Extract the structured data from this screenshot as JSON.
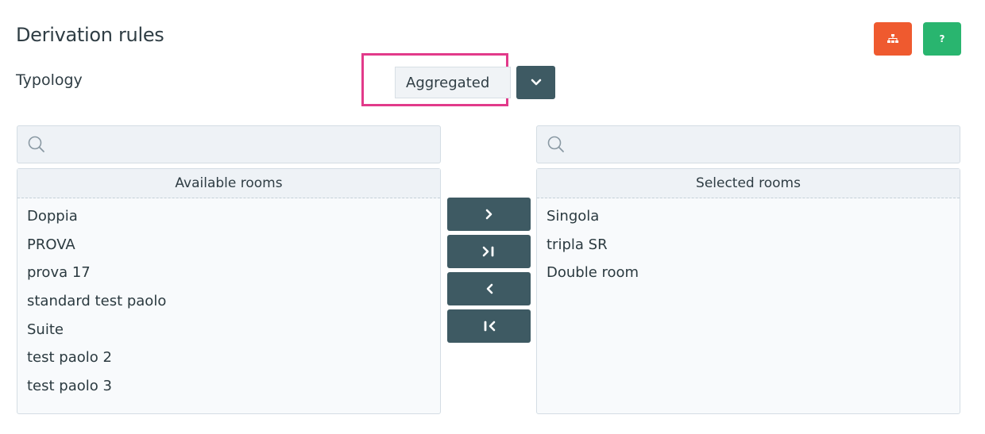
{
  "header": {
    "title": "Derivation rules",
    "hierarchy_button_icon": "sitemap-icon",
    "help_button_label": "?"
  },
  "colors": {
    "orange_button": "#ef5a2f",
    "green_button": "#29b56f",
    "dark_button": "#3e5a63",
    "highlight_border": "#e23a8a"
  },
  "typology": {
    "label": "Typology",
    "selected": "Aggregated"
  },
  "available": {
    "search_placeholder": "",
    "header": "Available rooms",
    "items": [
      "Doppia",
      "PROVA",
      "prova 17",
      "standard test paolo",
      "Suite",
      "test paolo 2",
      "test paolo 3"
    ]
  },
  "selected": {
    "search_placeholder": "",
    "header": "Selected rooms",
    "items": [
      "Singola",
      "tripla SR",
      "Double room"
    ]
  },
  "transfer": {
    "move_one_icon": "chevron-right-icon",
    "move_all_icon": "chevron-right-bar-icon",
    "remove_one_icon": "chevron-left-icon",
    "remove_all_icon": "bar-chevron-left-icon"
  }
}
